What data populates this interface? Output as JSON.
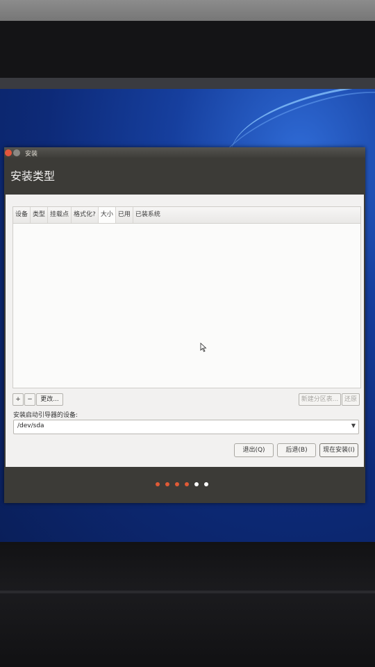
{
  "window": {
    "title": "安装"
  },
  "header": {
    "title": "安装类型"
  },
  "partition_table": {
    "columns": [
      "设备",
      "类型",
      "挂载点",
      "格式化?",
      "大小",
      "已用",
      "已装系统"
    ],
    "rows": []
  },
  "toolbar": {
    "add_label": "+",
    "remove_label": "−",
    "change_label": "更改...",
    "new_table_label": "新建分区表...",
    "revert_label": "还原"
  },
  "bootloader": {
    "label": "安装启动引导器的设备:",
    "selected_device": "/dev/sda"
  },
  "actions": {
    "quit_label": "退出(Q)",
    "back_label": "后退(B)",
    "install_label": "现在安装(I)"
  },
  "progress": {
    "total_steps": 6,
    "completed_steps": 4,
    "completed_color": "#e05a36",
    "pending_color": "#ffffff"
  }
}
